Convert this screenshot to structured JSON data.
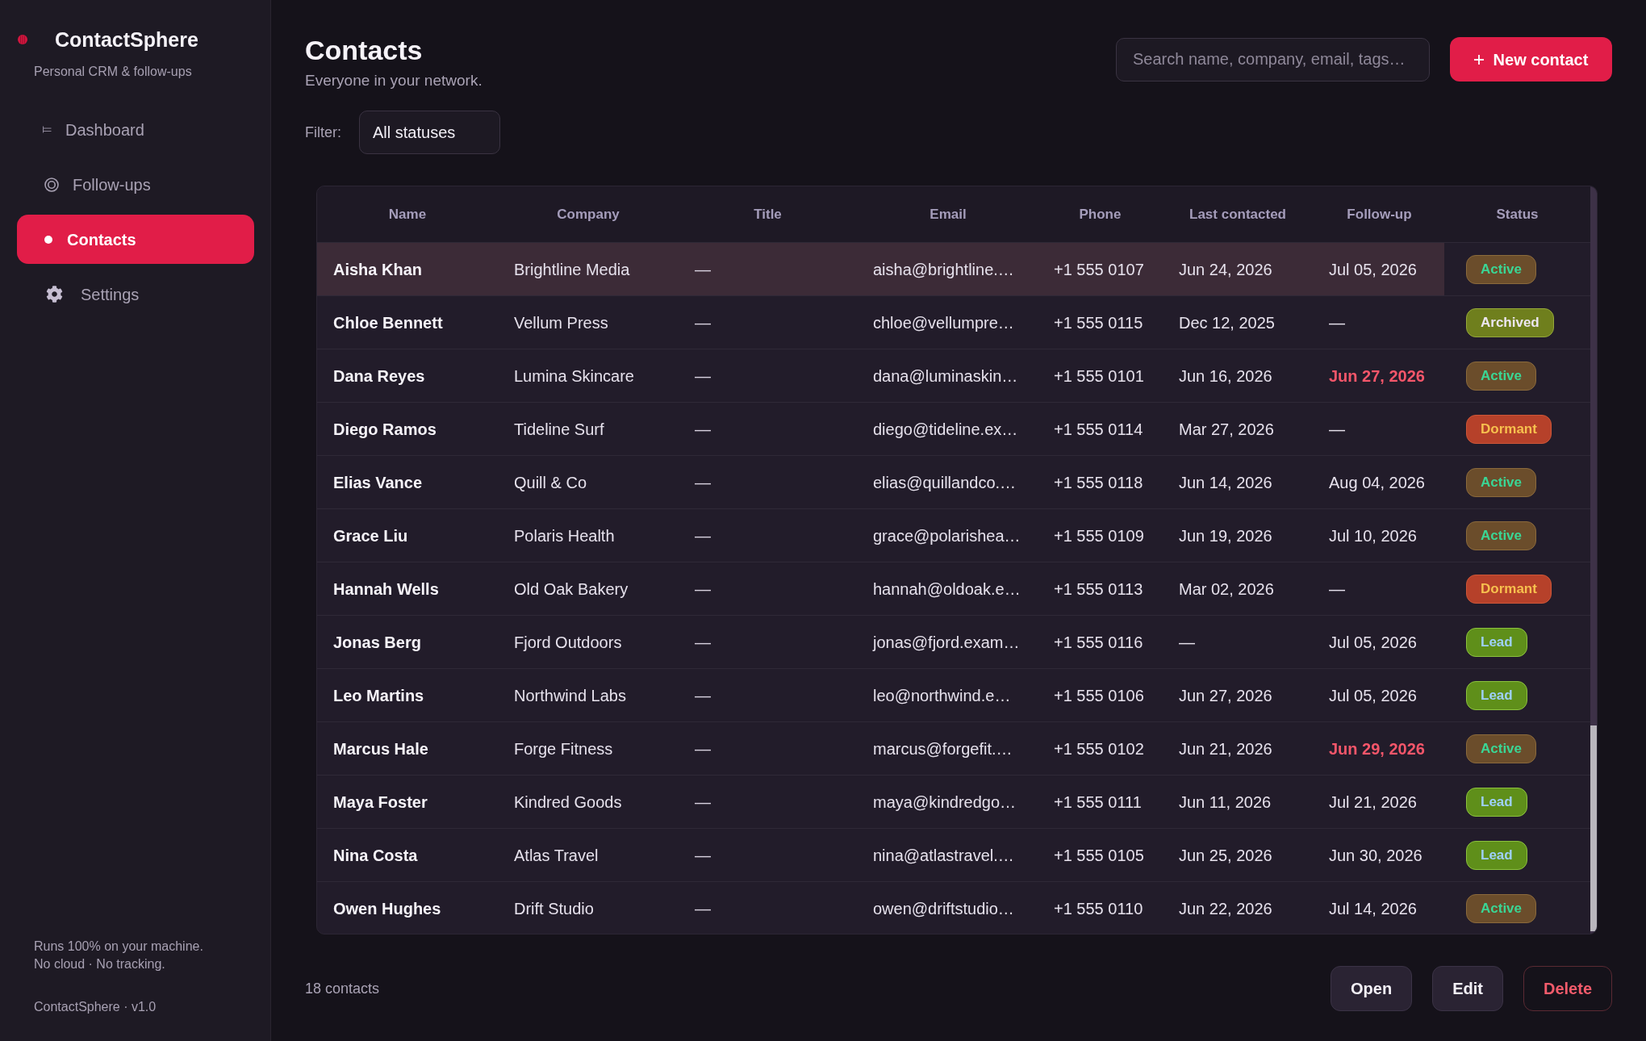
{
  "sidebar": {
    "brand": {
      "title": "ContactSphere",
      "subtitle": "Personal CRM & follow-ups"
    },
    "nav": [
      {
        "label": "Dashboard",
        "kind": "dashboard",
        "selected": false
      },
      {
        "label": "Follow-ups",
        "kind": "followups",
        "selected": false
      },
      {
        "label": "Contacts",
        "kind": "contacts",
        "selected": true
      },
      {
        "label": "Settings",
        "kind": "settings",
        "selected": false
      }
    ],
    "footer_note": [
      "Runs 100% on your machine.",
      "No cloud · No tracking."
    ],
    "version": "ContactSphere · v1.0"
  },
  "header": {
    "title": "Contacts",
    "subtitle": "Everyone in your network.",
    "search": {
      "placeholder": "Search name, company, email, tags…"
    },
    "new_button": "New contact"
  },
  "filter": {
    "label": "Filter:",
    "value": "All statuses"
  },
  "table": {
    "columns": [
      "Name",
      "Company",
      "Title",
      "Email",
      "Phone",
      "Last contacted",
      "Follow-up",
      "Status"
    ],
    "rows": [
      {
        "selected": true,
        "name": "Aisha Khan",
        "company": "Brightline Media",
        "title": "—",
        "email": "aisha@brightline.…",
        "phone": "+1 555 0107",
        "last_contacted": "Jun 24, 2026",
        "follow_up": "Jul 05, 2026",
        "overdue": false,
        "status": {
          "label": "Active",
          "kind": "active"
        }
      },
      {
        "selected": false,
        "name": "Chloe Bennett",
        "company": "Vellum Press",
        "title": "—",
        "email": "chloe@vellumpre…",
        "phone": "+1 555 0115",
        "last_contacted": "Dec 12, 2025",
        "follow_up": "—",
        "overdue": false,
        "status": {
          "label": "Archived",
          "kind": "archived"
        }
      },
      {
        "selected": false,
        "name": "Dana Reyes",
        "company": "Lumina Skincare",
        "title": "—",
        "email": "dana@luminaskin…",
        "phone": "+1 555 0101",
        "last_contacted": "Jun 16, 2026",
        "follow_up": "Jun 27, 2026",
        "overdue": true,
        "status": {
          "label": "Active",
          "kind": "active"
        }
      },
      {
        "selected": false,
        "name": "Diego Ramos",
        "company": "Tideline Surf",
        "title": "—",
        "email": "diego@tideline.ex…",
        "phone": "+1 555 0114",
        "last_contacted": "Mar 27, 2026",
        "follow_up": "—",
        "overdue": false,
        "status": {
          "label": "Dormant",
          "kind": "dormant"
        }
      },
      {
        "selected": false,
        "name": "Elias Vance",
        "company": "Quill & Co",
        "title": "—",
        "email": "elias@quillandco.…",
        "phone": "+1 555 0118",
        "last_contacted": "Jun 14, 2026",
        "follow_up": "Aug 04, 2026",
        "overdue": false,
        "status": {
          "label": "Active",
          "kind": "active"
        }
      },
      {
        "selected": false,
        "name": "Grace Liu",
        "company": "Polaris Health",
        "title": "—",
        "email": "grace@polarishea…",
        "phone": "+1 555 0109",
        "last_contacted": "Jun 19, 2026",
        "follow_up": "Jul 10, 2026",
        "overdue": false,
        "status": {
          "label": "Active",
          "kind": "active"
        }
      },
      {
        "selected": false,
        "name": "Hannah Wells",
        "company": "Old Oak Bakery",
        "title": "—",
        "email": "hannah@oldoak.e…",
        "phone": "+1 555 0113",
        "last_contacted": "Mar 02, 2026",
        "follow_up": "—",
        "overdue": false,
        "status": {
          "label": "Dormant",
          "kind": "dormant"
        }
      },
      {
        "selected": false,
        "name": "Jonas Berg",
        "company": "Fjord Outdoors",
        "title": "—",
        "email": "jonas@fjord.exam…",
        "phone": "+1 555 0116",
        "last_contacted": "—",
        "follow_up": "Jul 05, 2026",
        "overdue": false,
        "status": {
          "label": "Lead",
          "kind": "lead"
        }
      },
      {
        "selected": false,
        "name": "Leo Martins",
        "company": "Northwind Labs",
        "title": "—",
        "email": "leo@northwind.e…",
        "phone": "+1 555 0106",
        "last_contacted": "Jun 27, 2026",
        "follow_up": "Jul 05, 2026",
        "overdue": false,
        "status": {
          "label": "Lead",
          "kind": "lead"
        }
      },
      {
        "selected": false,
        "name": "Marcus Hale",
        "company": "Forge Fitness",
        "title": "—",
        "email": "marcus@forgefit.…",
        "phone": "+1 555 0102",
        "last_contacted": "Jun 21, 2026",
        "follow_up": "Jun 29, 2026",
        "overdue": true,
        "status": {
          "label": "Active",
          "kind": "active"
        }
      },
      {
        "selected": false,
        "name": "Maya Foster",
        "company": "Kindred Goods",
        "title": "—",
        "email": "maya@kindredgo…",
        "phone": "+1 555 0111",
        "last_contacted": "Jun 11, 2026",
        "follow_up": "Jul 21, 2026",
        "overdue": false,
        "status": {
          "label": "Lead",
          "kind": "lead"
        }
      },
      {
        "selected": false,
        "name": "Nina Costa",
        "company": "Atlas Travel",
        "title": "—",
        "email": "nina@atlastravel.…",
        "phone": "+1 555 0105",
        "last_contacted": "Jun 25, 2026",
        "follow_up": "Jun 30, 2026",
        "overdue": false,
        "status": {
          "label": "Lead",
          "kind": "lead"
        }
      },
      {
        "selected": false,
        "name": "Owen Hughes",
        "company": "Drift Studio",
        "title": "—",
        "email": "owen@driftstudio…",
        "phone": "+1 555 0110",
        "last_contacted": "Jun 22, 2026",
        "follow_up": "Jul 14, 2026",
        "overdue": false,
        "status": {
          "label": "Active",
          "kind": "active"
        }
      }
    ]
  },
  "footer": {
    "count": "18 contacts",
    "buttons": [
      {
        "label": "Open",
        "kind": "default"
      },
      {
        "label": "Edit",
        "kind": "default"
      },
      {
        "label": "Delete",
        "kind": "danger"
      }
    ]
  }
}
